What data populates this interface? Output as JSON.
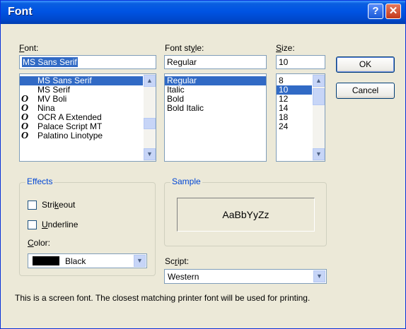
{
  "window": {
    "title": "Font",
    "help_label": "?",
    "close_label": "✕"
  },
  "font": {
    "label_underline": "F",
    "label_rest": "ont:",
    "value": "MS Sans Serif",
    "items": [
      {
        "name": "MS Sans Serif",
        "icon": "",
        "selected": true
      },
      {
        "name": "MS Serif",
        "icon": "",
        "selected": false
      },
      {
        "name": "MV Boli",
        "icon": "O",
        "selected": false
      },
      {
        "name": "Nina",
        "icon": "O",
        "selected": false
      },
      {
        "name": "OCR A Extended",
        "icon": "O",
        "selected": false
      },
      {
        "name": "Palace Script MT",
        "icon": "O",
        "selected": false
      },
      {
        "name": "Palatino Linotype",
        "icon": "O",
        "selected": false
      }
    ]
  },
  "style": {
    "label_pre": "Font st",
    "label_underline": "y",
    "label_rest": "le:",
    "value": "Regular",
    "items": [
      "Regular",
      "Italic",
      "Bold",
      "Bold Italic"
    ],
    "selected": "Regular"
  },
  "size": {
    "label_underline": "S",
    "label_rest": "ize:",
    "value": "10",
    "items": [
      "8",
      "10",
      "12",
      "14",
      "18",
      "24"
    ],
    "selected": "10"
  },
  "buttons": {
    "ok": "OK",
    "cancel": "Cancel"
  },
  "effects": {
    "title": "Effects",
    "strikeout_pre": "Stri",
    "strikeout_underline": "k",
    "strikeout_rest": "eout",
    "underline_underline": "U",
    "underline_rest": "nderline",
    "color_underline": "C",
    "color_rest": "olor:",
    "color_value": "Black",
    "color_swatch": "#000000"
  },
  "sample": {
    "title": "Sample",
    "text": "AaBbYyZz"
  },
  "script": {
    "label_pre": "Sc",
    "label_underline": "r",
    "label_rest": "ipt:",
    "value": "Western"
  },
  "footer": "This is a screen font. The closest matching printer font will be used for printing."
}
